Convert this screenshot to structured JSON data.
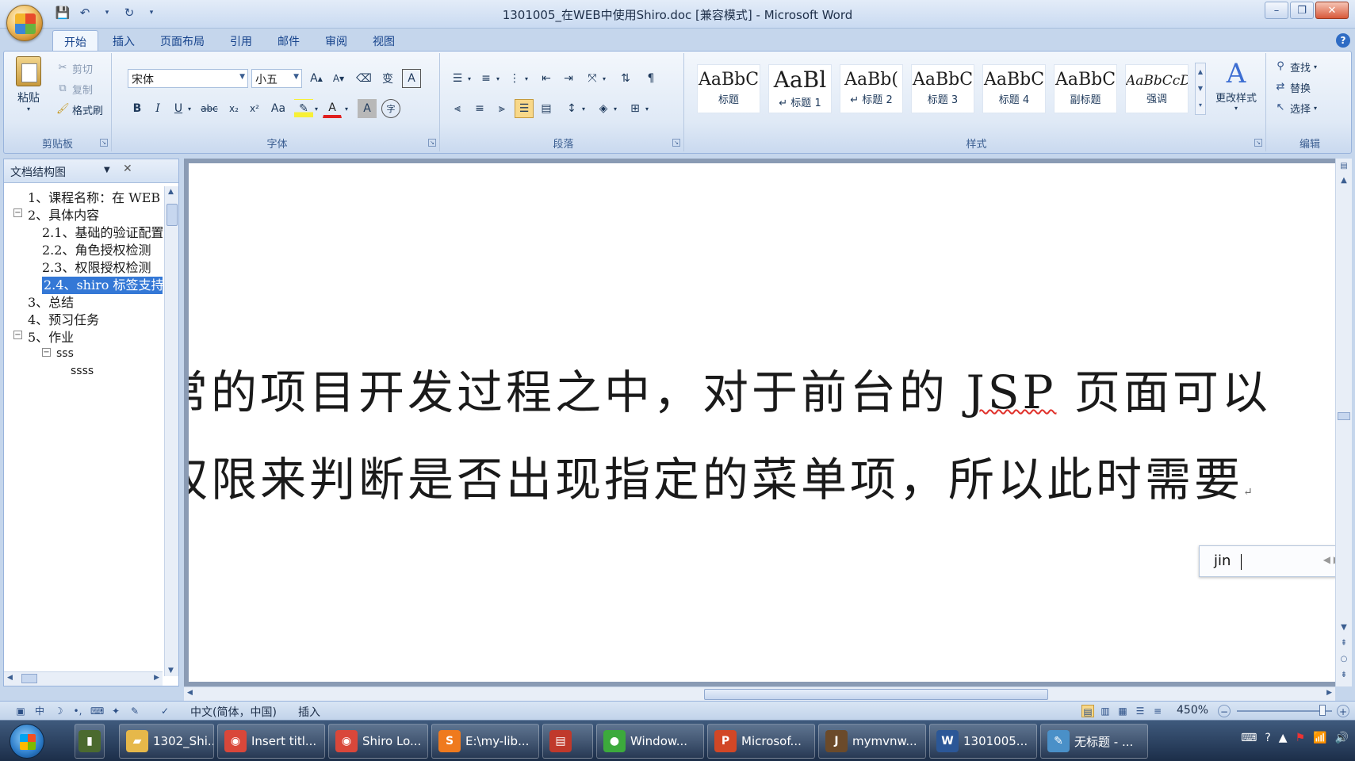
{
  "window": {
    "title": "1301005_在WEB中使用Shiro.doc [兼容模式] - Microsoft Word"
  },
  "tabs": [
    "开始",
    "插入",
    "页面布局",
    "引用",
    "邮件",
    "审阅",
    "视图"
  ],
  "ribbon": {
    "clipboard": {
      "label": "剪贴板",
      "paste": "粘贴",
      "cut": "剪切",
      "copy": "复制",
      "format_painter": "格式刷"
    },
    "font": {
      "label": "字体",
      "font_name": "宋体",
      "font_size": "小五",
      "wen_btn": "变",
      "bold": "B",
      "italic": "I",
      "underline": "U",
      "strike": "abc",
      "sub": "x₂",
      "sup": "x²",
      "case": "Aa",
      "char_shading": "A",
      "char_border": "A",
      "grow": "A",
      "shrink": "A",
      "font_color": "A",
      "enclose": "字"
    },
    "paragraph": {
      "label": "段落"
    },
    "styles": {
      "label": "样式",
      "items": [
        {
          "sample": "AaBbC",
          "name": "标题"
        },
        {
          "sample": "AaBl",
          "name": "↵ 标题 1"
        },
        {
          "sample": "AaBb(",
          "name": "↵ 标题 2"
        },
        {
          "sample": "AaBbC",
          "name": "标题 3"
        },
        {
          "sample": "AaBbC",
          "name": "标题 4"
        },
        {
          "sample": "AaBbC",
          "name": "副标题"
        },
        {
          "sample": "AaBbCcDc",
          "name": "强调"
        }
      ],
      "change_styles": "更改样式"
    },
    "editing": {
      "label": "编辑",
      "find": "查找",
      "replace": "替换",
      "select": "选择"
    }
  },
  "nav_pane": {
    "title": "文档结构图",
    "items": [
      {
        "text": "1、课程名称：在 WEB"
      },
      {
        "text": "2、具体内容"
      },
      {
        "text": "2.1、基础的验证配置"
      },
      {
        "text": "2.2、角色授权检测"
      },
      {
        "text": "2.3、权限授权检测"
      },
      {
        "text": "2.4、shiro 标签支持"
      },
      {
        "text": "3、总结"
      },
      {
        "text": "4、预习任务"
      },
      {
        "text": "5、作业"
      },
      {
        "text": "sss"
      },
      {
        "text": "ssss"
      }
    ]
  },
  "document": {
    "line1_a": "常的项目开发过程之中，对于前台的 ",
    "line1_jsp": "JSP",
    "line1_b": " 页面可以",
    "line2": "权限来判断是否出现指定的菜单项，所以此时需要"
  },
  "ime": {
    "input": "jin"
  },
  "statusbar": {
    "language": "中文(简体，中国)",
    "mode": "插入",
    "zoom": "450%"
  },
  "taskbar": {
    "tasks": [
      {
        "label": "1302_Shi...",
        "icon": "folder-icon",
        "color": "#e6b84a"
      },
      {
        "label": "Insert titl...",
        "icon": "chrome-icon",
        "color": "#d9473a"
      },
      {
        "label": "Shiro Lo...",
        "icon": "chrome-icon",
        "color": "#d9473a"
      },
      {
        "label": "E:\\my-lib...",
        "icon": "sublime-icon",
        "color": "#ef7a1e"
      },
      {
        "label": "",
        "icon": "pdf-icon",
        "color": "#c0392b"
      },
      {
        "label": "Window...",
        "icon": "green-app-icon",
        "color": "#3caa3c"
      },
      {
        "label": "Microsof...",
        "icon": "powerpoint-icon",
        "color": "#d24726"
      },
      {
        "label": "mymvnw...",
        "icon": "java-ide-icon",
        "color": "#6b4a2a"
      },
      {
        "label": "1301005...",
        "icon": "word-doc-icon",
        "color": "#2b5797"
      },
      {
        "label": "无标题 - ...",
        "icon": "paint-icon",
        "color": "#4a90c8"
      }
    ]
  }
}
